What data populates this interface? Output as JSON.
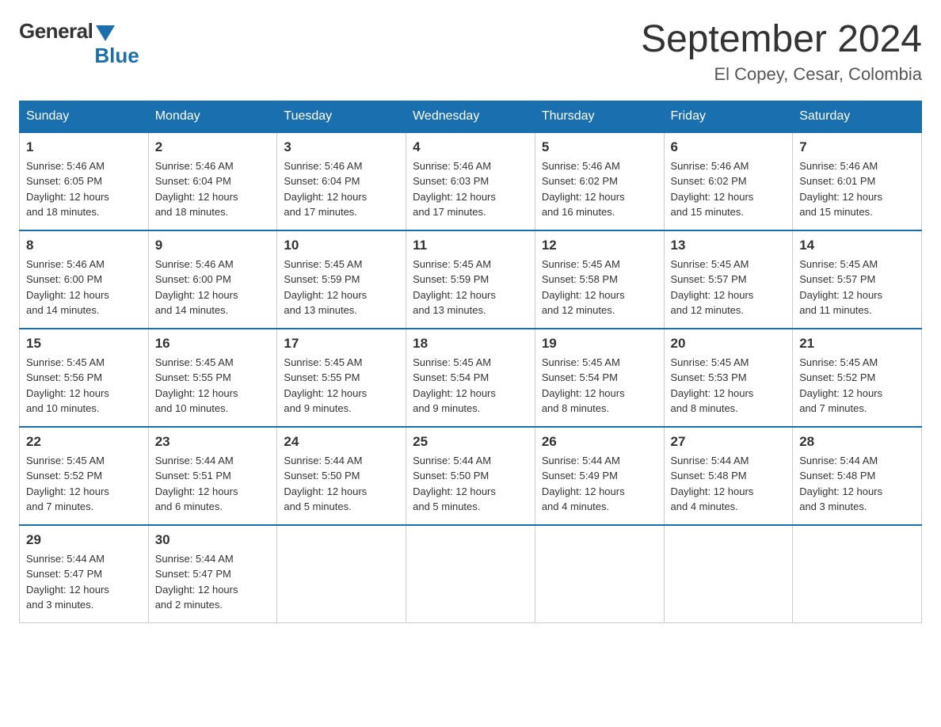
{
  "header": {
    "title": "September 2024",
    "subtitle": "El Copey, Cesar, Colombia",
    "logo_general": "General",
    "logo_blue": "Blue"
  },
  "days_of_week": [
    "Sunday",
    "Monday",
    "Tuesday",
    "Wednesday",
    "Thursday",
    "Friday",
    "Saturday"
  ],
  "weeks": [
    [
      {
        "day": "1",
        "sunrise": "5:46 AM",
        "sunset": "6:05 PM",
        "daylight": "12 hours and 18 minutes."
      },
      {
        "day": "2",
        "sunrise": "5:46 AM",
        "sunset": "6:04 PM",
        "daylight": "12 hours and 18 minutes."
      },
      {
        "day": "3",
        "sunrise": "5:46 AM",
        "sunset": "6:04 PM",
        "daylight": "12 hours and 17 minutes."
      },
      {
        "day": "4",
        "sunrise": "5:46 AM",
        "sunset": "6:03 PM",
        "daylight": "12 hours and 17 minutes."
      },
      {
        "day": "5",
        "sunrise": "5:46 AM",
        "sunset": "6:02 PM",
        "daylight": "12 hours and 16 minutes."
      },
      {
        "day": "6",
        "sunrise": "5:46 AM",
        "sunset": "6:02 PM",
        "daylight": "12 hours and 15 minutes."
      },
      {
        "day": "7",
        "sunrise": "5:46 AM",
        "sunset": "6:01 PM",
        "daylight": "12 hours and 15 minutes."
      }
    ],
    [
      {
        "day": "8",
        "sunrise": "5:46 AM",
        "sunset": "6:00 PM",
        "daylight": "12 hours and 14 minutes."
      },
      {
        "day": "9",
        "sunrise": "5:46 AM",
        "sunset": "6:00 PM",
        "daylight": "12 hours and 14 minutes."
      },
      {
        "day": "10",
        "sunrise": "5:45 AM",
        "sunset": "5:59 PM",
        "daylight": "12 hours and 13 minutes."
      },
      {
        "day": "11",
        "sunrise": "5:45 AM",
        "sunset": "5:59 PM",
        "daylight": "12 hours and 13 minutes."
      },
      {
        "day": "12",
        "sunrise": "5:45 AM",
        "sunset": "5:58 PM",
        "daylight": "12 hours and 12 minutes."
      },
      {
        "day": "13",
        "sunrise": "5:45 AM",
        "sunset": "5:57 PM",
        "daylight": "12 hours and 12 minutes."
      },
      {
        "day": "14",
        "sunrise": "5:45 AM",
        "sunset": "5:57 PM",
        "daylight": "12 hours and 11 minutes."
      }
    ],
    [
      {
        "day": "15",
        "sunrise": "5:45 AM",
        "sunset": "5:56 PM",
        "daylight": "12 hours and 10 minutes."
      },
      {
        "day": "16",
        "sunrise": "5:45 AM",
        "sunset": "5:55 PM",
        "daylight": "12 hours and 10 minutes."
      },
      {
        "day": "17",
        "sunrise": "5:45 AM",
        "sunset": "5:55 PM",
        "daylight": "12 hours and 9 minutes."
      },
      {
        "day": "18",
        "sunrise": "5:45 AM",
        "sunset": "5:54 PM",
        "daylight": "12 hours and 9 minutes."
      },
      {
        "day": "19",
        "sunrise": "5:45 AM",
        "sunset": "5:54 PM",
        "daylight": "12 hours and 8 minutes."
      },
      {
        "day": "20",
        "sunrise": "5:45 AM",
        "sunset": "5:53 PM",
        "daylight": "12 hours and 8 minutes."
      },
      {
        "day": "21",
        "sunrise": "5:45 AM",
        "sunset": "5:52 PM",
        "daylight": "12 hours and 7 minutes."
      }
    ],
    [
      {
        "day": "22",
        "sunrise": "5:45 AM",
        "sunset": "5:52 PM",
        "daylight": "12 hours and 7 minutes."
      },
      {
        "day": "23",
        "sunrise": "5:44 AM",
        "sunset": "5:51 PM",
        "daylight": "12 hours and 6 minutes."
      },
      {
        "day": "24",
        "sunrise": "5:44 AM",
        "sunset": "5:50 PM",
        "daylight": "12 hours and 5 minutes."
      },
      {
        "day": "25",
        "sunrise": "5:44 AM",
        "sunset": "5:50 PM",
        "daylight": "12 hours and 5 minutes."
      },
      {
        "day": "26",
        "sunrise": "5:44 AM",
        "sunset": "5:49 PM",
        "daylight": "12 hours and 4 minutes."
      },
      {
        "day": "27",
        "sunrise": "5:44 AM",
        "sunset": "5:48 PM",
        "daylight": "12 hours and 4 minutes."
      },
      {
        "day": "28",
        "sunrise": "5:44 AM",
        "sunset": "5:48 PM",
        "daylight": "12 hours and 3 minutes."
      }
    ],
    [
      {
        "day": "29",
        "sunrise": "5:44 AM",
        "sunset": "5:47 PM",
        "daylight": "12 hours and 3 minutes."
      },
      {
        "day": "30",
        "sunrise": "5:44 AM",
        "sunset": "5:47 PM",
        "daylight": "12 hours and 2 minutes."
      },
      null,
      null,
      null,
      null,
      null
    ]
  ],
  "labels": {
    "sunrise": "Sunrise:",
    "sunset": "Sunset:",
    "daylight": "Daylight:"
  }
}
